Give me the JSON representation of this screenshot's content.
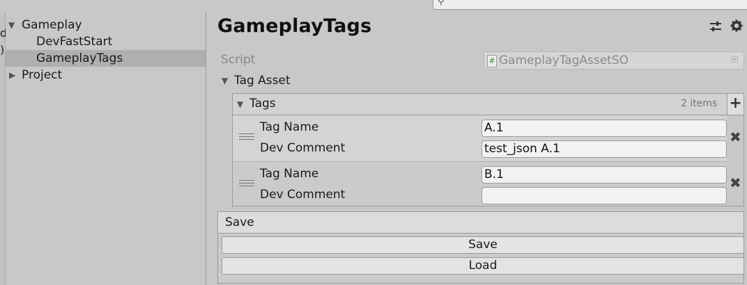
{
  "search": {
    "icon": "search-icon"
  },
  "left_edge": {
    "chars": [
      "d",
      ")"
    ]
  },
  "tree": {
    "items": [
      {
        "label": "Gameplay",
        "expanded": true
      },
      {
        "label": "DevFastStart"
      },
      {
        "label": "GameplayTags",
        "selected": true
      },
      {
        "label": "Project",
        "expanded": false
      }
    ]
  },
  "inspector": {
    "title": "GameplayTags",
    "icons": [
      "sliders-icon",
      "gear-icon"
    ],
    "script": {
      "label": "Script",
      "value": "GameplayTagAssetSO",
      "hash": "#"
    },
    "tag_asset": {
      "label": "Tag Asset"
    },
    "tags": {
      "label": "Tags",
      "count": "2 items",
      "add": "+",
      "elements": [
        {
          "tag_name_label": "Tag Name",
          "tag_name": "A.1",
          "dev_comment_label": "Dev Comment",
          "dev_comment": "test_json A.1",
          "remove": "✖"
        },
        {
          "tag_name_label": "Tag Name",
          "tag_name": "B.1",
          "dev_comment_label": "Dev Comment",
          "dev_comment": "",
          "remove": "✖"
        }
      ]
    },
    "save_section": {
      "header": "Save",
      "save_button": "Save",
      "load_button": "Load"
    }
  },
  "colors": {
    "panel": "#c8c8c8",
    "selected_row": "#afafaf",
    "field": "#f2f2f2"
  }
}
